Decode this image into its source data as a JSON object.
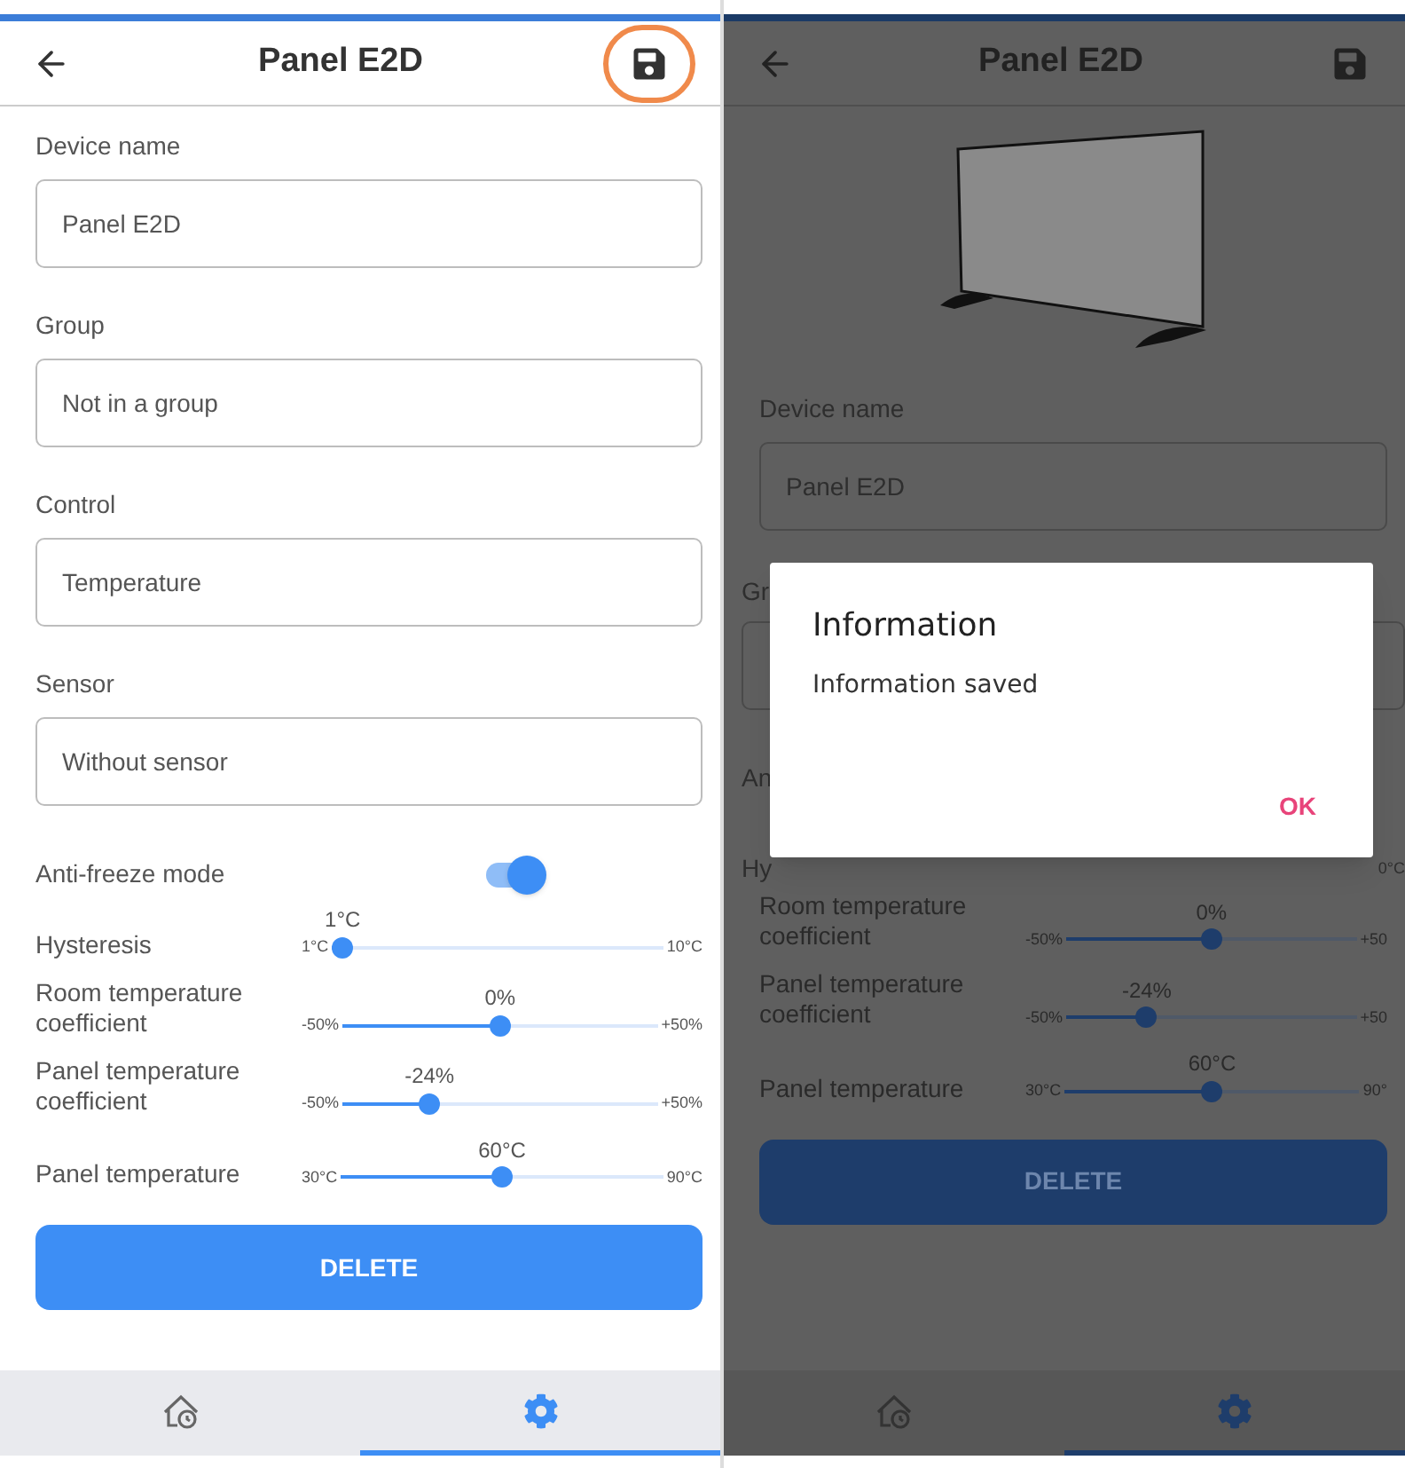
{
  "screens": [
    {
      "dimmed": false,
      "title": "Panel E2D",
      "save_highlighted": true,
      "device_image": false,
      "fields": [
        {
          "label": "Device name",
          "value": "Panel E2D"
        },
        {
          "label": "Group",
          "value": "Not in a group"
        },
        {
          "label": "Control",
          "value": "Temperature"
        },
        {
          "label": "Sensor",
          "value": "Without sensor"
        }
      ],
      "toggle": {
        "label": "Anti-freeze mode",
        "on": true
      },
      "sliders": [
        {
          "label": "Hysteresis",
          "value": "1°C",
          "min": "1°C",
          "max": "10°C",
          "level": 0
        },
        {
          "label": "Room temperature coefficient",
          "value": "0%",
          "min": "-50%",
          "max": "+50%",
          "level": 0.5
        },
        {
          "label": "Panel temperature coefficient",
          "value": "-24%",
          "min": "-50%",
          "max": "+50%",
          "level": 0.26
        },
        {
          "label": "Panel temperature",
          "value": "60°C",
          "min": "30°C",
          "max": "90°C",
          "level": 0.5
        }
      ],
      "delete_button": "DELETE",
      "nav": [
        {
          "kind": "home",
          "selected": false
        },
        {
          "kind": "settings",
          "selected": true
        }
      ]
    },
    {
      "dimmed": true,
      "title": "Panel E2D",
      "save_highlighted": false,
      "device_image": true,
      "fields": [
        {
          "label": "Device name",
          "value": "Panel E2D"
        }
      ],
      "covered": {
        "group_label": "Gr",
        "toggle_label": "An",
        "slider_label": "Hy",
        "slider_max": "0°C"
      },
      "dialog": {
        "title": "Information",
        "message": "Information saved",
        "button": "OK"
      },
      "sliders": [
        {
          "label": "Room temperature coefficient",
          "value": "0%",
          "min": "-50%",
          "max": "+50",
          "level": 0.5
        },
        {
          "label": "Panel temperature coefficient",
          "value": "-24%",
          "min": "-50%",
          "max": "+50",
          "level": 0.26
        },
        {
          "label": "Panel temperature",
          "value": "60°C",
          "min": "30°C",
          "max": "90°",
          "level": 0.5
        }
      ],
      "delete_button": "DELETE",
      "nav": [
        {
          "kind": "home",
          "selected": false
        },
        {
          "kind": "settings",
          "selected": true
        }
      ]
    }
  ]
}
